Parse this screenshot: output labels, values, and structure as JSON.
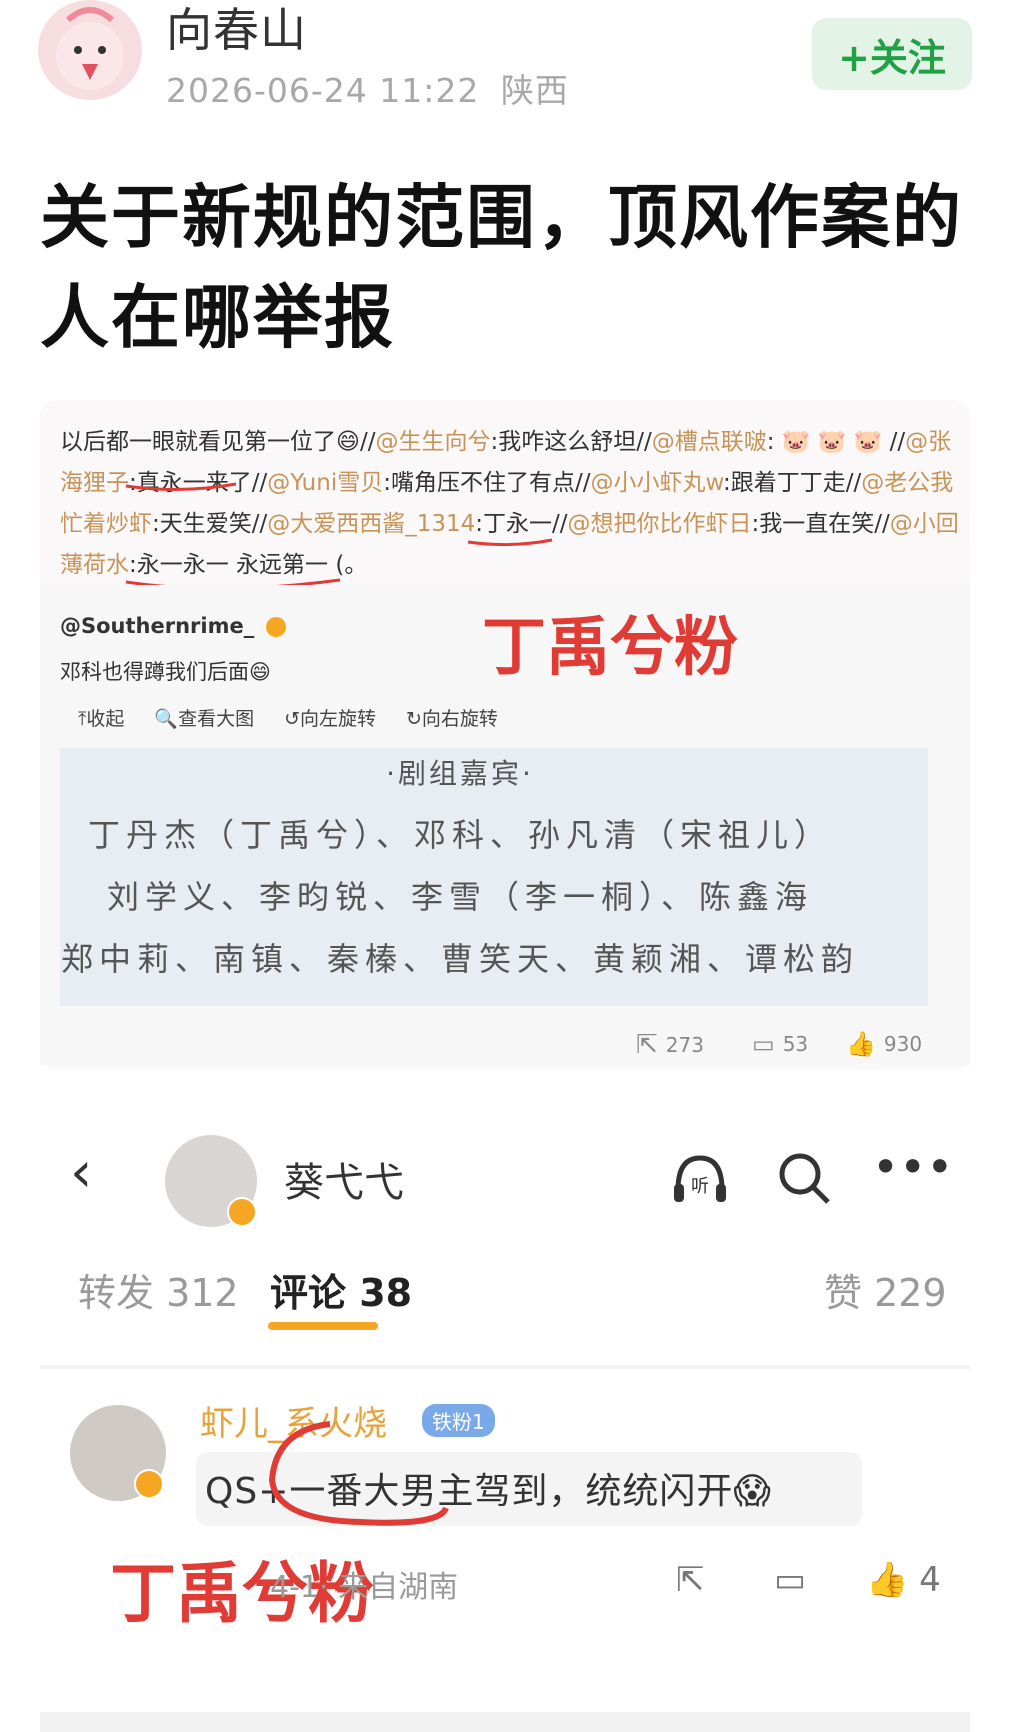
{
  "post": {
    "author": "向春山",
    "date": "2026-06-24 11:22",
    "location": "陕西",
    "follow_label": "+关注",
    "title_line1": "关于新规的范围，顶风作案的",
    "title_line2": "人在哪举报"
  },
  "embedded1": {
    "repost_segments": [
      {
        "t": "以后都一眼就看见第一位了",
        "c": "txt"
      },
      {
        "t": "😄",
        "c": "txt"
      },
      {
        "t": "//",
        "c": "txt"
      },
      {
        "t": "@生生向兮",
        "c": "at"
      },
      {
        "t": ":我咋这么舒坦//",
        "c": "txt"
      },
      {
        "t": "@槽点联啵",
        "c": "at"
      },
      {
        "t": ": 🐷 🐷 🐷 //",
        "c": "txt"
      },
      {
        "t": "@张海狸子",
        "c": "at"
      },
      {
        "t": ":真永一来了//",
        "c": "txt"
      },
      {
        "t": "@Yuni雪贝",
        "c": "at"
      },
      {
        "t": ":嘴角压不住了有点//",
        "c": "txt"
      },
      {
        "t": "@小小虾丸w",
        "c": "at"
      },
      {
        "t": ":跟着丁丁走//",
        "c": "txt"
      },
      {
        "t": "@老公我忙着炒虾",
        "c": "at"
      },
      {
        "t": ":天生爱笑//",
        "c": "txt"
      },
      {
        "t": "@大爱西西酱_1314",
        "c": "at"
      },
      {
        "t": ":丁永一//",
        "c": "txt"
      },
      {
        "t": "@想把你比作虾日",
        "c": "at"
      },
      {
        "t": ":我一直在笑//",
        "c": "txt"
      },
      {
        "t": "@小回薄荷水",
        "c": "at"
      },
      {
        "t": ":永一永一 永远第一 (。",
        "c": "txt"
      }
    ],
    "source_user": "@Southernrime_",
    "source_text": "邓科也得蹲我们后面😄",
    "red_label": "丁禹兮粉",
    "toolbar": [
      "⤒收起",
      "🔍查看大图",
      "↺向左旋转",
      "↻向右旋转"
    ],
    "poster_title": "·剧组嘉宾·",
    "poster_lines": [
      "丁丹杰（丁禹兮）、邓科、孙凡清（宋祖儿）",
      "刘学义、李昀锐、李雪（李一桐）、陈鑫海",
      "郑中莉、南镇、秦榛、曹笑天、黄颖湘、谭松韵"
    ],
    "reposts": "273",
    "comments": "53",
    "likes": "930"
  },
  "embedded2": {
    "user": "葵弋弋",
    "tabs": {
      "repost": "转发 312",
      "comment": "评论 38",
      "like": "赞 229"
    },
    "comment": {
      "name": "虾儿_系火烧",
      "badge": "铁粉1",
      "text": "QS+一番大男主驾到，统统闪开😱",
      "location": "4-1· 来自湖南",
      "likes": "4"
    },
    "red_label": "丁禹兮粉"
  },
  "colors": {
    "accent_green": "#21a146",
    "at_color": "#c99358",
    "red": "#e03b35",
    "tab_indicator": "#f5a623"
  }
}
